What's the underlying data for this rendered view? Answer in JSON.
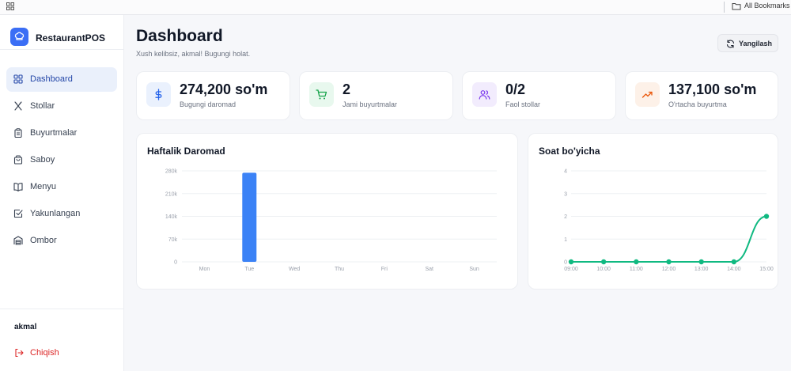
{
  "browser": {
    "bookmarks_label": "All Bookmarks"
  },
  "sidebar": {
    "brand": "RestaurantPOS",
    "items": [
      {
        "label": "Dashboard",
        "icon": "grid-icon",
        "active": true
      },
      {
        "label": "Stollar",
        "icon": "utensils-icon"
      },
      {
        "label": "Buyurtmalar",
        "icon": "clipboard-icon"
      },
      {
        "label": "Saboy",
        "icon": "bag-icon"
      },
      {
        "label": "Menyu",
        "icon": "book-icon"
      },
      {
        "label": "Yakunlangan",
        "icon": "check-square-icon"
      },
      {
        "label": "Ombor",
        "icon": "warehouse-icon"
      }
    ],
    "user": "akmal",
    "logout_label": "Chiqish"
  },
  "header": {
    "title": "Dashboard",
    "subtitle": "Xush kelibsiz, akmal! Bugungi holat.",
    "refresh_label": "Yangilash"
  },
  "stats": [
    {
      "value": "274,200 so'm",
      "label": "Bugungi daromad",
      "icon": "dollar-icon",
      "color": "#2563eb",
      "bg": "#eaf1fd"
    },
    {
      "value": "2",
      "label": "Jami buyurtmalar",
      "icon": "cart-icon",
      "color": "#16a34a",
      "bg": "#e8f8ee"
    },
    {
      "value": "0/2",
      "label": "Faol stollar",
      "icon": "users-icon",
      "color": "#7c3aed",
      "bg": "#f2ecfd"
    },
    {
      "value": "137,100 so'm",
      "label": "O'rtacha buyurtma",
      "icon": "trending-up-icon",
      "color": "#ea580c",
      "bg": "#fdf1e8"
    }
  ],
  "chart_data": [
    {
      "type": "bar",
      "title": "Haftalik Daromad",
      "categories": [
        "Mon",
        "Tue",
        "Wed",
        "Thu",
        "Fri",
        "Sat",
        "Sun"
      ],
      "values": [
        0,
        274200,
        0,
        0,
        0,
        0,
        0
      ],
      "yticks": [
        "0",
        "70k",
        "140k",
        "210k",
        "280k"
      ],
      "ylim": [
        0,
        280000
      ],
      "color": "#3b82f6",
      "grid": true
    },
    {
      "type": "line",
      "title": "Soat bo'yicha",
      "x": [
        "09:00",
        "10:00",
        "11:00",
        "12:00",
        "13:00",
        "14:00",
        "15:00"
      ],
      "values": [
        0,
        0,
        0,
        0,
        0,
        0,
        2
      ],
      "yticks": [
        "0",
        "1",
        "2",
        "3",
        "4"
      ],
      "ylim": [
        0,
        4
      ],
      "color": "#10b981",
      "grid": true
    }
  ]
}
